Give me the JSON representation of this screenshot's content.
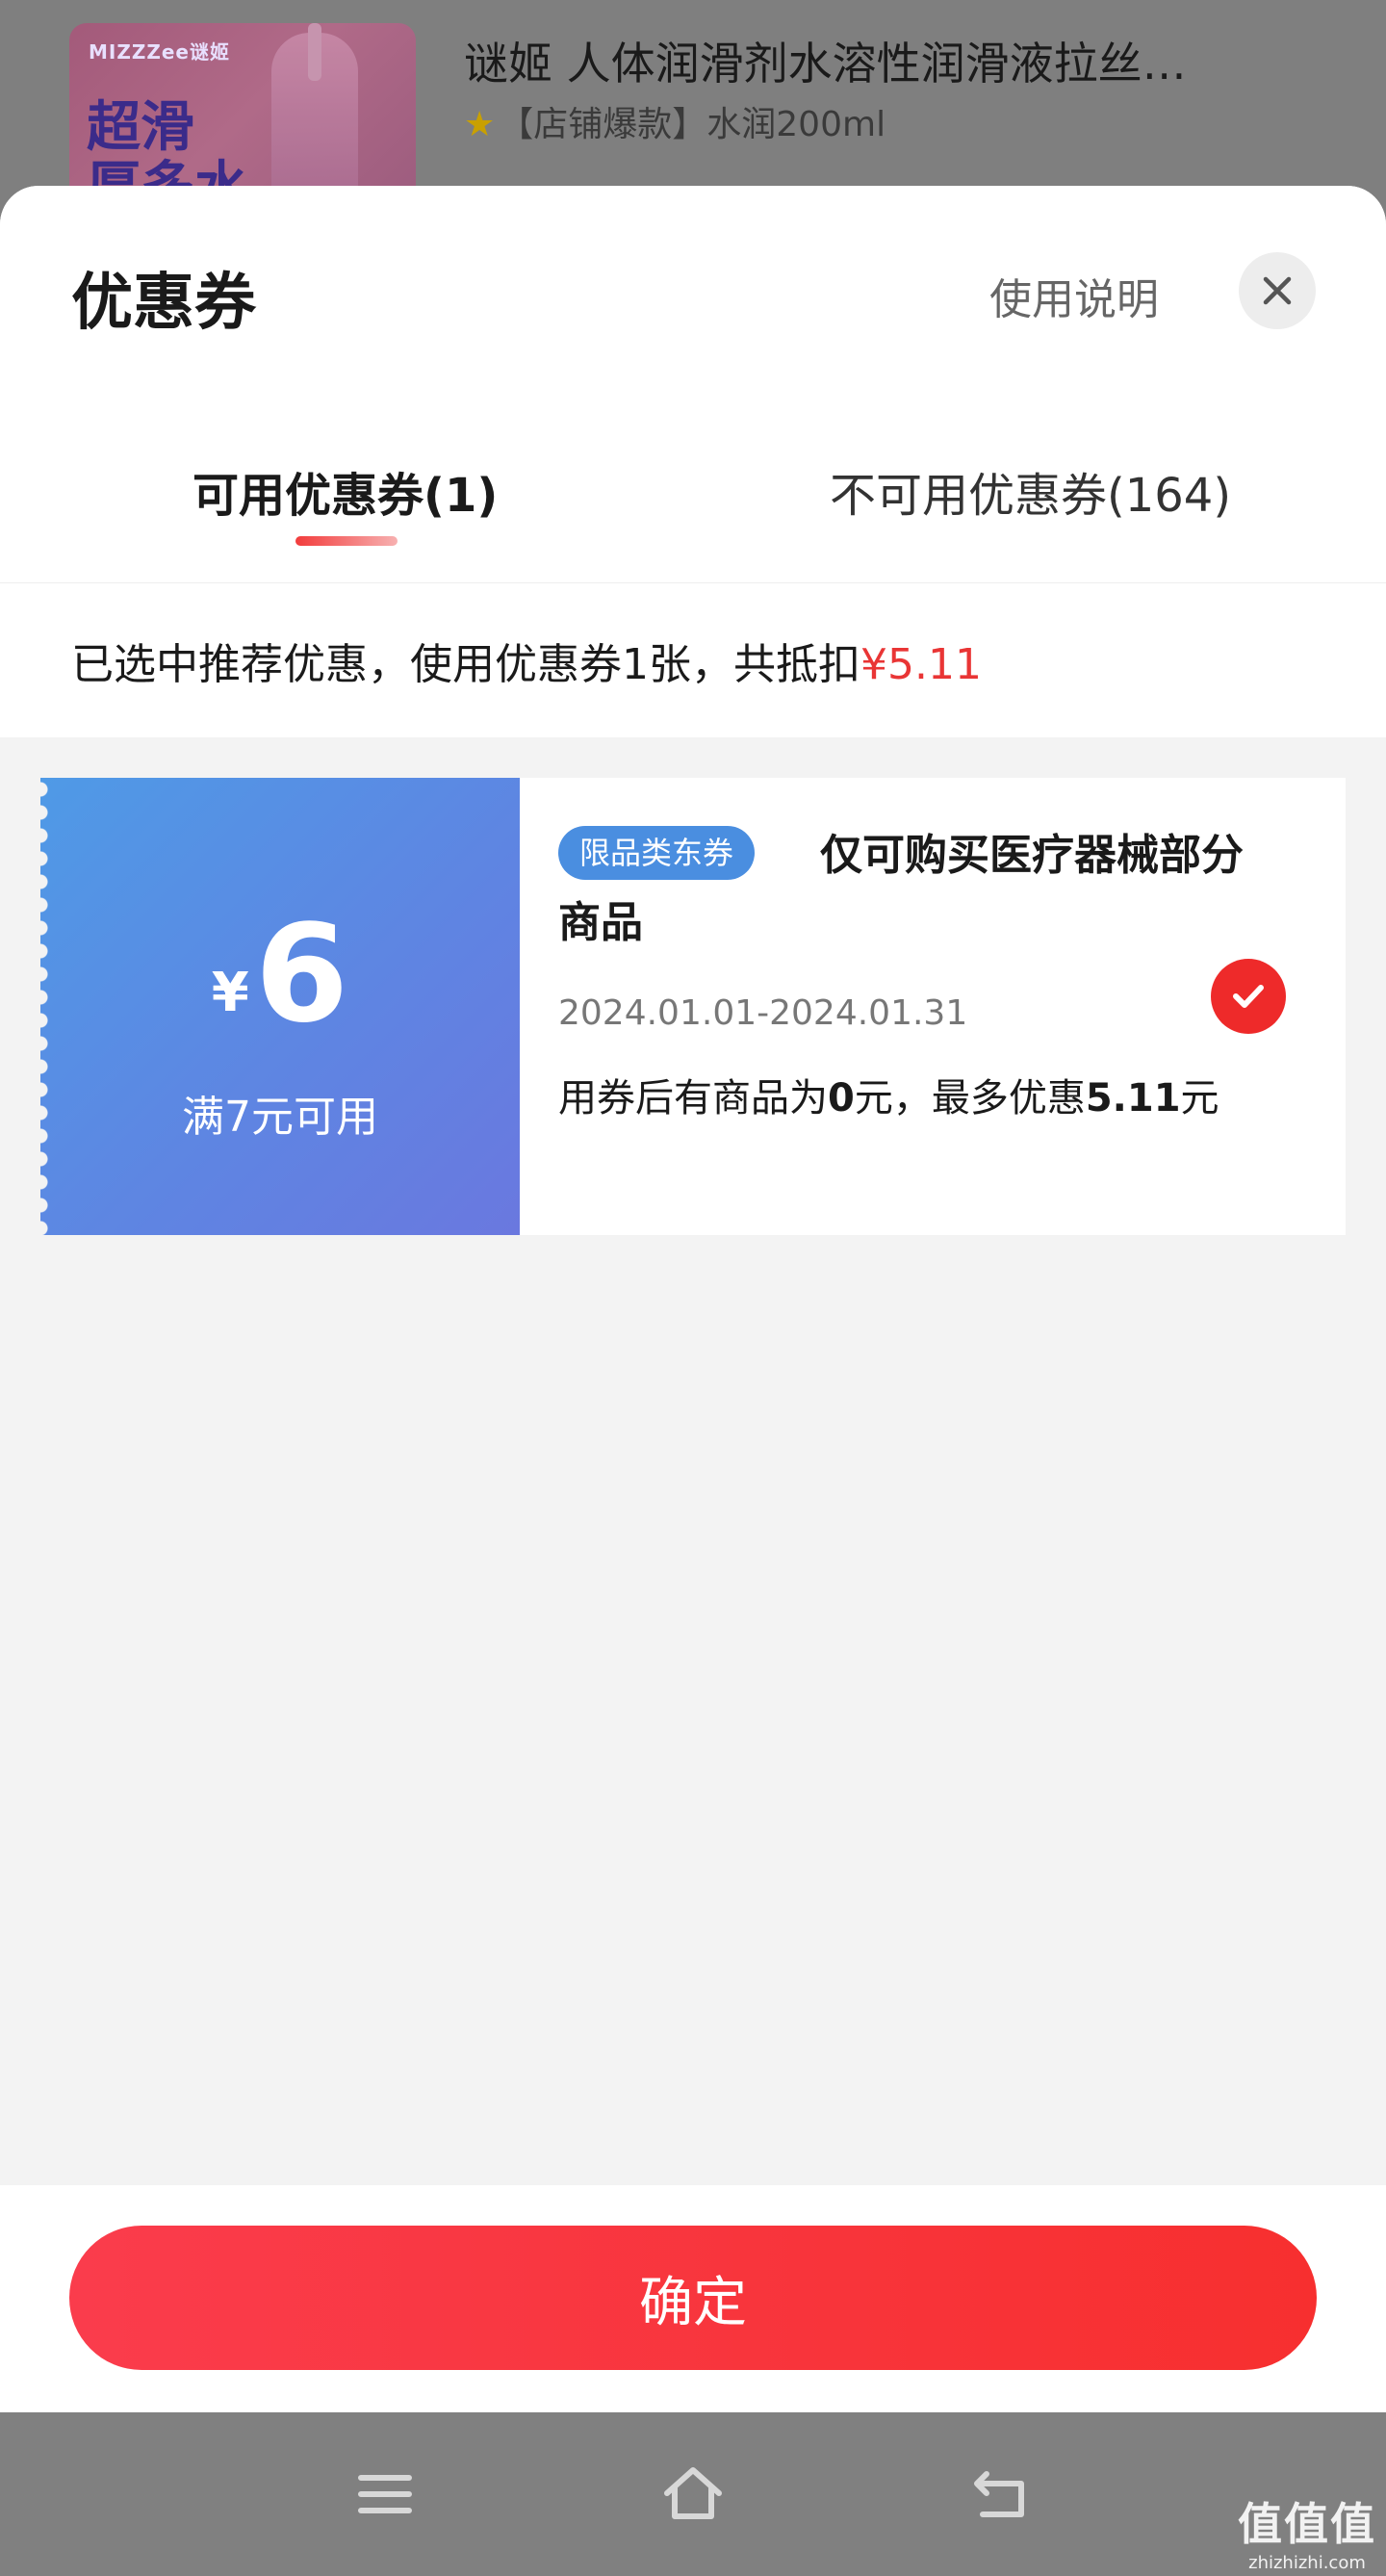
{
  "background_product": {
    "thumb_brand": "MIZZZee谜姬",
    "thumb_headline": "超滑",
    "thumb_headline2": "厚多水",
    "title": "谜姬 人体润滑剂水溶性润滑液拉丝…",
    "subtitle": "【店铺爆款】水润200ml"
  },
  "sheet": {
    "title": "优惠券",
    "help_link": "使用说明",
    "tabs": [
      {
        "label": "可用优惠券(1)",
        "active": true
      },
      {
        "label": "不可用优惠券(164)",
        "active": false
      }
    ],
    "summary_prefix": "已选中推荐优惠，使用优惠券1张，共抵扣",
    "summary_amount": "¥5.11"
  },
  "coupon": {
    "currency": "¥",
    "amount": "6",
    "threshold": "满7元可用",
    "tag": "限品类东券",
    "description": "仅可购买医疗器械部分商品",
    "validity": "2024.01.01-2024.01.31",
    "rule_part1": "用券后有商品为",
    "rule_bold1": "0",
    "rule_part2": "元，最多优惠",
    "rule_bold2": "5.11",
    "rule_part3": "元",
    "selected": true
  },
  "footer": {
    "confirm_label": "确定"
  },
  "watermark": {
    "big": "值值值",
    "small": "zhizhizhi.com"
  },
  "colors": {
    "accent_red": "#e93535",
    "coupon_blue": "#5f84e2",
    "button_red": "#f72f2f"
  },
  "icons": {
    "close": "close-icon",
    "check": "check-icon",
    "nav_menu": "menu-icon",
    "nav_home": "home-icon",
    "nav_back": "back-icon"
  }
}
